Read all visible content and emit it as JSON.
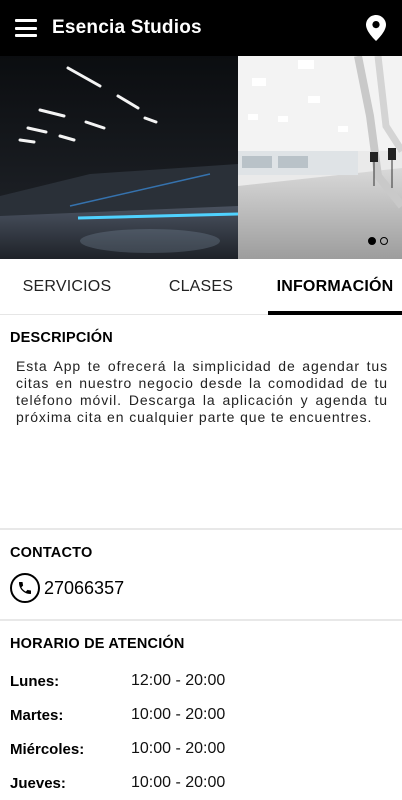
{
  "app_bar": {
    "title": "Esencia Studios",
    "menu_icon": "hamburger-menu-icon",
    "location_icon": "map-pin-icon"
  },
  "gallery": {
    "slides": 2,
    "active_slide": 1
  },
  "tabs": [
    {
      "label": "SERVICIOS",
      "active": false
    },
    {
      "label": "CLASES",
      "active": false
    },
    {
      "label": "INFORMACIÓN",
      "active": true
    }
  ],
  "description": {
    "title": "DESCRIPCIÓN",
    "text": "Esta App te ofrecerá la simplicidad de agendar tus citas en nuestro negocio desde la comodidad de tu teléfono móvil. Descarga la aplicación y agenda tu próxima cita en cualquier parte que te encuentres."
  },
  "contact": {
    "title": "CONTACTO",
    "phone_icon": "phone-icon",
    "phone": "27066357"
  },
  "hours": {
    "title": "HORARIO DE ATENCIÓN",
    "rows": [
      {
        "day": "Lunes:",
        "time": "12:00 - 20:00"
      },
      {
        "day": "Martes:",
        "time": "10:00 - 20:00"
      },
      {
        "day": "Miércoles:",
        "time": "10:00 - 20:00"
      },
      {
        "day": "Jueves:",
        "time": "10:00 - 20:00"
      }
    ]
  },
  "colors": {
    "app_bar": "#000000",
    "accent": "#000000",
    "divider": "#e8e8e8"
  }
}
